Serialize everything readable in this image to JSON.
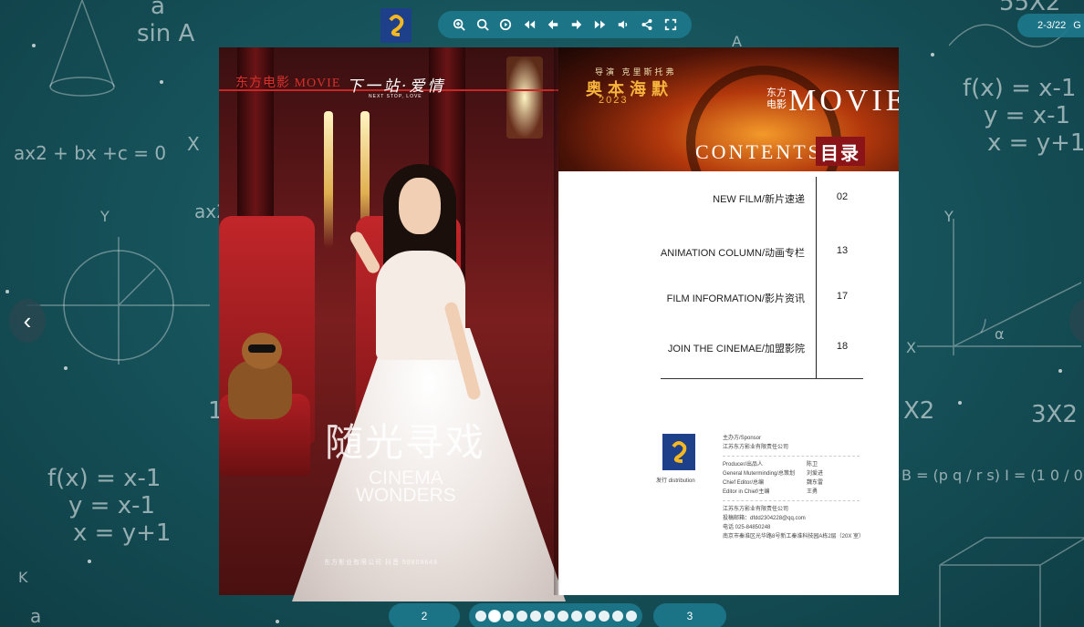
{
  "toolbar": {
    "buttons": [
      "zoom-in",
      "zoom-out",
      "autoplay",
      "first-page",
      "previous-page",
      "next-page",
      "last-page",
      "sound",
      "share",
      "fullscreen"
    ]
  },
  "pager_top": {
    "label": "2-3/22",
    "go": "G"
  },
  "chalkboard": {
    "frac_top": "a",
    "sin": "sin A",
    "quad": "ax2 + bx +c = 0",
    "x_left": "X",
    "ax2": "ax2",
    "eq1": "f(x) = x-1",
    "eq2": "y = x-1",
    "eq3": "x = y+1",
    "r_eq1": "f(x) = x-1",
    "r_eq2": "y = x-1",
    "r_eq3": "x = y+1",
    "y_left": "Y",
    "y_right": "Y",
    "x_right": "X",
    "alpha": "α",
    "x2": "X2",
    "x3x2": "3X2",
    "matrix": "B = (p q / r s)   I = (1 0 / 0 1)",
    "top_right": "55X2",
    "a_bottom": "a",
    "k": "K",
    "one_left": "1",
    "three_x": "3X2",
    "a_top": "A"
  },
  "book": {
    "left_page": {
      "movie": "东方电影 MOVIE",
      "title": "下一站·爱情",
      "subtitle": "NEXT STOP, LOVE",
      "big_cn": "随光寻戏",
      "cinema_1": "CINEMA",
      "cinema_2": "WONDERS",
      "footer": "东方影业有限公司   抖音  50809649"
    },
    "right_page": {
      "banner_small": "导演 克里斯托弗",
      "banner_cn": "奥本海默",
      "banner_year": "2023",
      "dfdy": "东方电影",
      "movie": "MOVIE",
      "contents": "CONTENTS",
      "mulu": "目录",
      "toc": [
        {
          "title": "NEW FILM/新片速递",
          "page": "02"
        },
        {
          "title": "ANIMATION COLUMN/动画专栏",
          "page": "13"
        },
        {
          "title": "FILM INFORMATION/影片资讯",
          "page": "17"
        },
        {
          "title": "JOIN THE CINEMAE/加盟影院",
          "page": "18"
        }
      ],
      "dist": "发行 distribution",
      "sponsor_label": "主办方/Sponsor",
      "sponsor": "江苏东方影业有限责任公司",
      "staff": [
        {
          "k": "Producer/出品人",
          "v": "陈卫"
        },
        {
          "k": "General Muterminding/总策划",
          "v": "刘爱进"
        },
        {
          "k": "Chief Editor/总编",
          "v": "魏东雷"
        },
        {
          "k": "Editor in Chief/主编",
          "v": "王勇"
        }
      ],
      "company": "江苏东方影业有限责任公司",
      "email": "投稿邮箱：dfdd2304228@qq.com",
      "phone": "电话 025-84850248",
      "address": "南京市秦淮区光华路8号新工秦淮科技园A栋2层（20X 室）"
    }
  },
  "bottom": {
    "left_page_num": "2",
    "right_page_num": "3",
    "dot_count": 12,
    "active_dot": 1
  }
}
